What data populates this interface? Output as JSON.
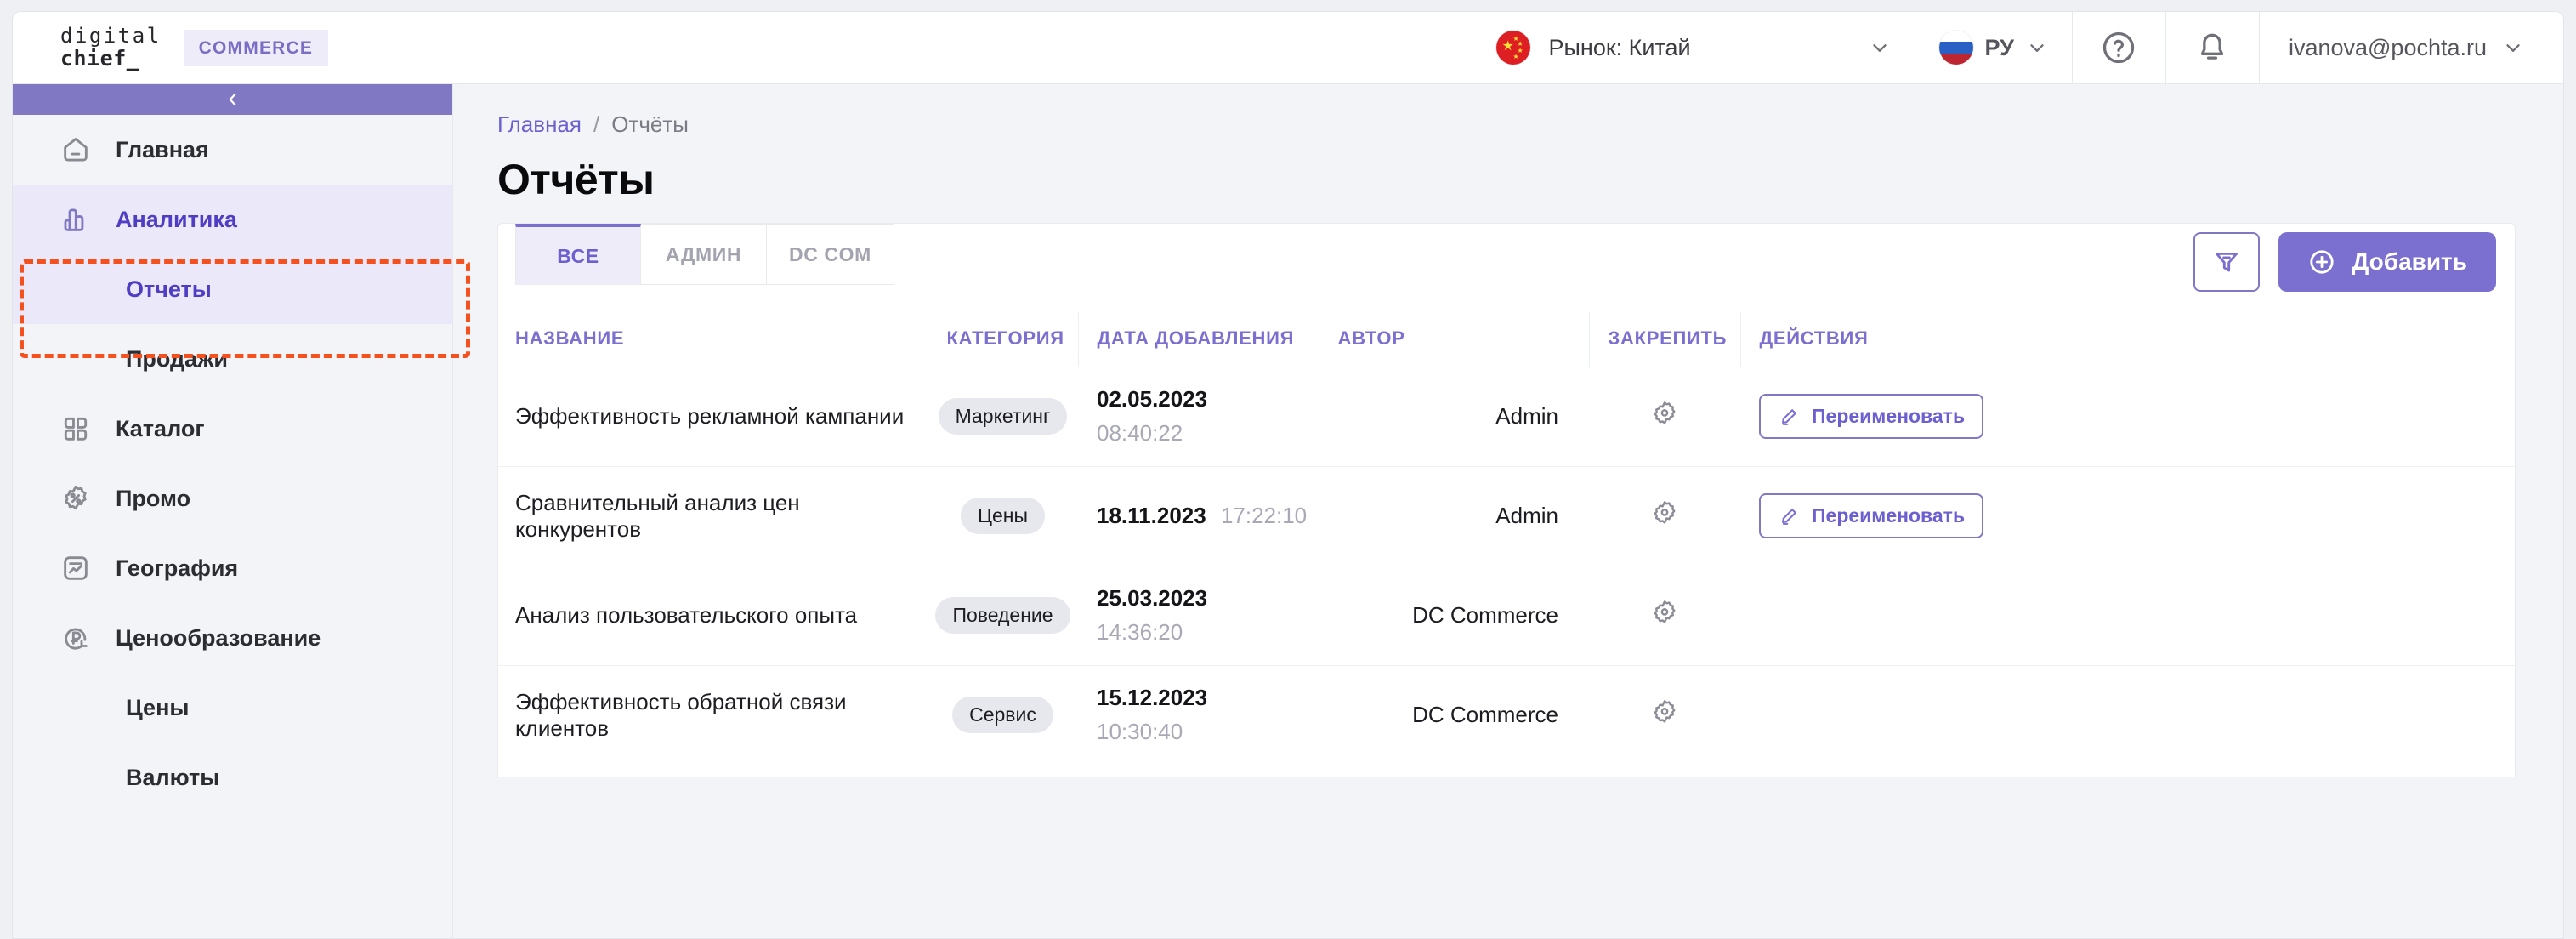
{
  "brand": {
    "logo_line1": "digital",
    "logo_line2": "chief_",
    "badge": "COMMERCE"
  },
  "topbar": {
    "market_label": "Рынок: Китай",
    "market_flag": "cn-flag-icon",
    "lang_label": "РУ",
    "lang_flag": "ru-flag-icon",
    "help_icon": "question-circle-icon",
    "notification_icon": "bell-icon",
    "user_email": "ivanova@pochta.ru"
  },
  "sidebar": {
    "collapse_icon": "chevron-left-icon",
    "items": [
      {
        "label": "Главная",
        "icon": "home-icon",
        "sub": false,
        "active": false
      },
      {
        "label": "Аналитика",
        "icon": "analytics-icon",
        "sub": false,
        "active": true
      },
      {
        "label": "Отчеты",
        "icon": "",
        "sub": true,
        "active": true
      },
      {
        "label": "Продажи",
        "icon": "",
        "sub": true,
        "active": false
      },
      {
        "label": "Каталог",
        "icon": "grid-icon",
        "sub": false,
        "active": false
      },
      {
        "label": "Промо",
        "icon": "percent-badge-icon",
        "sub": false,
        "active": false
      },
      {
        "label": "География",
        "icon": "chart-square-icon",
        "sub": false,
        "active": false
      },
      {
        "label": "Ценообразование",
        "icon": "ruble-refresh-icon",
        "sub": false,
        "active": false
      },
      {
        "label": "Цены",
        "icon": "",
        "sub": true,
        "active": false
      },
      {
        "label": "Валюты",
        "icon": "",
        "sub": true,
        "active": false
      }
    ]
  },
  "breadcrumb": {
    "home": "Главная",
    "separator": "/",
    "current": "Отчёты"
  },
  "page": {
    "title": "Отчёты"
  },
  "tabs": [
    {
      "label": "ВСЕ",
      "active": true
    },
    {
      "label": "АДМИН",
      "active": false
    },
    {
      "label": "DC COM",
      "active": false
    }
  ],
  "toolbar": {
    "filter_icon": "filter-icon",
    "add_icon": "plus-circle-icon",
    "add_label": "Добавить"
  },
  "table": {
    "columns": [
      "НАЗВАНИЕ",
      "КАТЕГОРИЯ",
      "ДАТА ДОБАВЛЕНИЯ",
      "АВТОР",
      "ЗАКРЕПИТЬ",
      "ДЕЙСТВИЯ"
    ],
    "rows": [
      {
        "name": "Эффективность рекламной кампании",
        "category": "Маркетинг",
        "date": "02.05.2023",
        "time": "08:40:22",
        "date_inline": false,
        "author": "Admin",
        "pin_icon": "gear-icon",
        "action_label": "Переименовать",
        "action_icon": "pencil-icon",
        "has_action": true
      },
      {
        "name": "Сравнительный анализ цен конкурентов",
        "category": "Цены",
        "date": "18.11.2023",
        "time": "17:22:10",
        "date_inline": true,
        "author": "Admin",
        "pin_icon": "gear-icon",
        "action_label": "Переименовать",
        "action_icon": "pencil-icon",
        "has_action": true
      },
      {
        "name": "Анализ пользовательского опыта",
        "category": "Поведение",
        "date": "25.03.2023",
        "time": "14:36:20",
        "date_inline": false,
        "author": "DC Commerce",
        "pin_icon": "gear-icon",
        "action_label": "",
        "action_icon": "",
        "has_action": false
      },
      {
        "name": "Эффективность обратной связи клиентов",
        "category": "Сервис",
        "date": "15.12.2023",
        "time": "10:30:40",
        "date_inline": false,
        "author": "DC Commerce",
        "pin_icon": "gear-icon",
        "action_label": "",
        "action_icon": "",
        "has_action": false
      }
    ]
  },
  "colors": {
    "accent": "#7b6fd0",
    "accent_soft": "#efecfa",
    "active_nav_bg": "#ebe9f9",
    "highlight_box": "#f4511e",
    "page_bg": "#f3f4f7",
    "badge_bg": "#e7e7ee",
    "muted_text": "#a9a9b6"
  },
  "annotation": {
    "highlight_target": "sidebar-analytics-reports-group"
  }
}
